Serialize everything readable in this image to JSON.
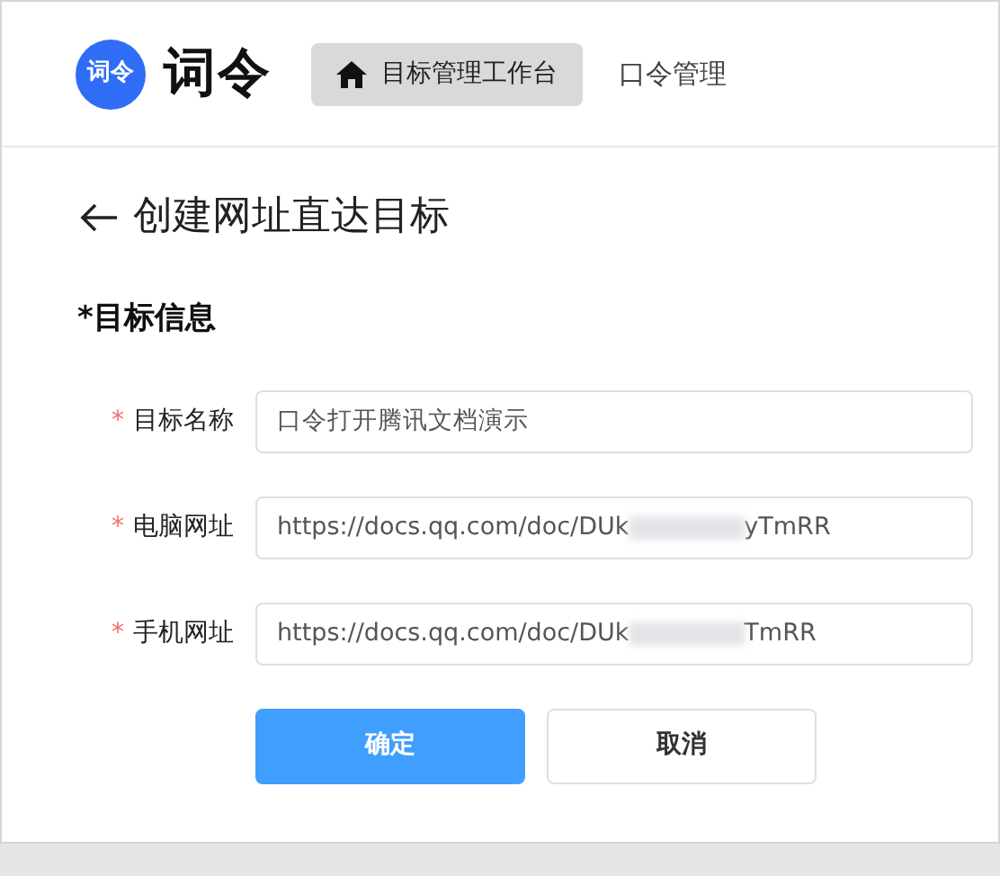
{
  "header": {
    "logo_badge": "词令",
    "logo_text": "词令",
    "nav": [
      {
        "label": "目标管理工作台",
        "selected": true
      },
      {
        "label": "口令管理",
        "selected": false
      }
    ]
  },
  "page_title": "创建网址直达目标",
  "section_title": "*目标信息",
  "fields": [
    {
      "required_mark": "*",
      "label": "目标名称",
      "value_start": "口令打开腾讯文档演示"
    },
    {
      "required_mark": "*",
      "label": "电脑网址",
      "value_start": "https://docs.qq.com/doc/DUk",
      "redacted": true,
      "value_end": "yTmRR"
    },
    {
      "required_mark": "*",
      "label": "手机网址",
      "value_start": "https://docs.qq.com/doc/DUk",
      "redacted": true,
      "value_end": "TmRR"
    }
  ],
  "buttons": [
    {
      "label": "确定",
      "kind": "primary"
    },
    {
      "label": "取消",
      "kind": "secondary"
    }
  ]
}
